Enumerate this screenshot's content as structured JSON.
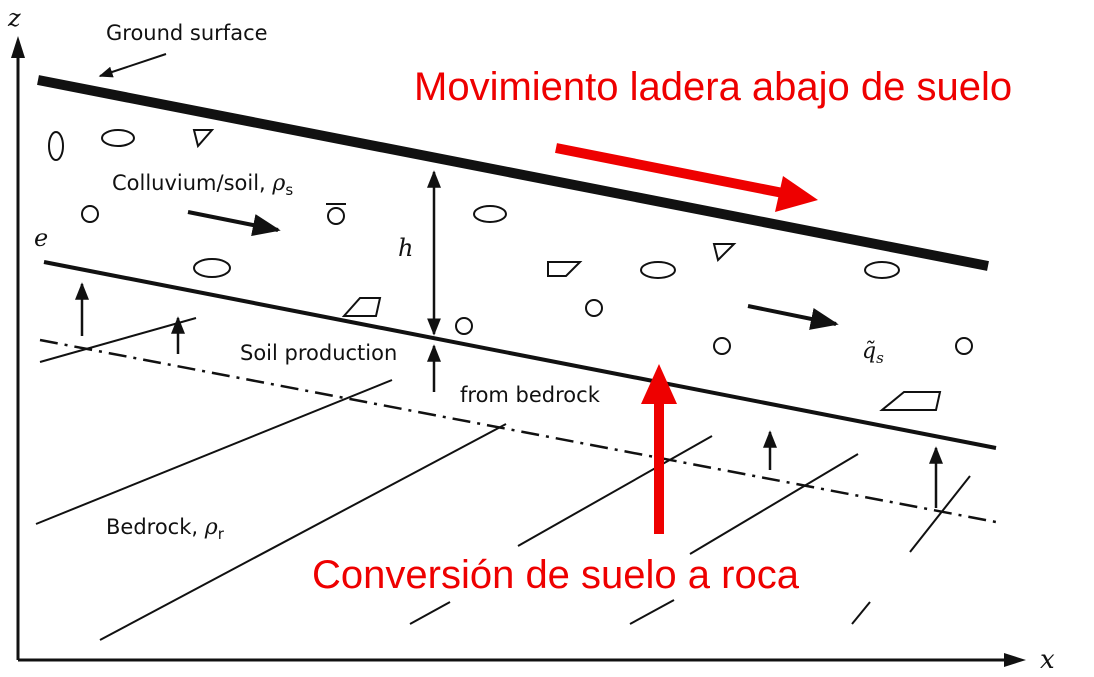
{
  "axes": {
    "z_label": "z",
    "x_label": "x"
  },
  "labels": {
    "ground_surface": "Ground surface",
    "colluvium_soil": "Colluvium/soil, ",
    "rho": "ρ",
    "sub_s": "s",
    "sub_r": "r",
    "elevation": "e",
    "thickness": "h",
    "soil_production": "Soil production",
    "from_bedrock": "from bedrock",
    "bedrock": "Bedrock, ",
    "flux_q": "q̃",
    "flux_sub": "s"
  },
  "annotations": {
    "downslope": "Movimiento ladera abajo de suelo",
    "conversion": "Conversión de suelo a roca"
  },
  "colors": {
    "annotation": "#ee0000",
    "ink": "#111111"
  }
}
